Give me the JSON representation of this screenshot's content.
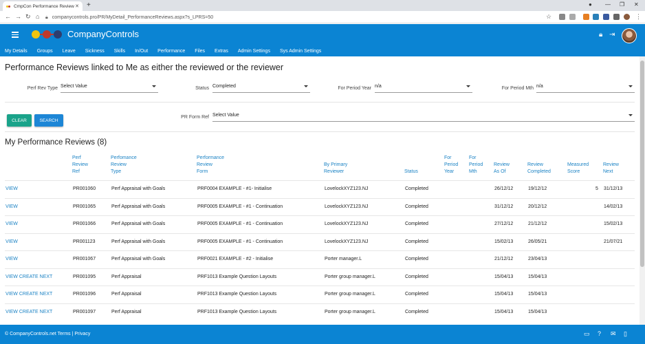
{
  "browser": {
    "tab_title": "CmpCon Performance Review",
    "url": "companycontrols.pro/PR/MyDetail_PerformanceReviews.aspx?s_LPRS=50"
  },
  "app": {
    "brand": "CompanyControls",
    "menu": [
      "My Details",
      "Groups",
      "Leave",
      "Sickness",
      "Skills",
      "In/Out",
      "Performance",
      "Files",
      "Extras",
      "Admin Settings",
      "Sys Admin Settings"
    ]
  },
  "page": {
    "title": "Performance Reviews linked to Me as either the reviewed or the reviewer",
    "filters": {
      "perf_rev_type_label": "Perf Rev Type",
      "perf_rev_type_value": "Select Value",
      "status_label": "Status",
      "status_value": "Completed",
      "period_year_label": "For Period Year",
      "period_year_value": "n/a",
      "period_mth_label": "For Period Mth",
      "period_mth_value": "n/a",
      "form_ref_label": "PR Form Ref",
      "form_ref_value": "Select Value"
    },
    "buttons": {
      "clear": "CLEAR",
      "search": "SEARCH"
    },
    "section_title": "My Performance Reviews (8)"
  },
  "table": {
    "headers": {
      "ref": "Perf\nReview\nRef",
      "type": "Perfomance\nReview\nType",
      "form": "Performance\nReview\nForm",
      "reviewer": "By Primary\nReviewer",
      "status": "Status",
      "year": "For\nPeriod\nYear",
      "mth": "For\nPeriod\nMth",
      "asof": "Review\nAs Of",
      "completed": "Review\nCompleted",
      "score": "Measured\nScore",
      "next": "Review\nNext"
    },
    "rows": [
      {
        "action": "VIEW",
        "ref": "PR001060",
        "type": "Perf Appraisal with Goals",
        "form": "PRF0004 EXAMPLE - #1- Initialise",
        "reviewer": "LovelockXYZ123.NJ",
        "status": "Completed",
        "asof": "26/12/12",
        "completed": "19/12/12",
        "score": "5",
        "next": "31/12/13"
      },
      {
        "action": "VIEW",
        "ref": "PR001065",
        "type": "Perf Appraisal with Goals",
        "form": "PRF0005 EXAMPLE - #1 - Continuation",
        "reviewer": "LovelockXYZ123.NJ",
        "status": "Completed",
        "asof": "31/12/12",
        "completed": "20/12/12",
        "score": "",
        "next": "14/02/13"
      },
      {
        "action": "VIEW",
        "ref": "PR001066",
        "type": "Perf Appraisal with Goals",
        "form": "PRF0005 EXAMPLE - #1 - Continuation",
        "reviewer": "LovelockXYZ123.NJ",
        "status": "Completed",
        "asof": "27/12/12",
        "completed": "21/12/12",
        "score": "",
        "next": "15/02/13"
      },
      {
        "action": "VIEW",
        "ref": "PR001123",
        "type": "Perf Appraisal with Goals",
        "form": "PRF0005 EXAMPLE - #1 - Continuation",
        "reviewer": "LovelockXYZ123.NJ",
        "status": "Completed",
        "asof": "15/02/13",
        "completed": "26/05/21",
        "score": "",
        "next": "21/07/21"
      },
      {
        "action": "VIEW",
        "ref": "PR001067",
        "type": "Perf Appraisal with Goals",
        "form": "PRF0021 EXAMPLE - #2 - Initialise",
        "reviewer": "Porter manager.L",
        "status": "Completed",
        "asof": "21/12/12",
        "completed": "23/04/13",
        "score": "",
        "next": ""
      },
      {
        "action": "VIEW CREATE NEXT",
        "ref": "PR001095",
        "type": "Perf Appraisal",
        "form": "PRF1013 Example Question Layouts",
        "reviewer": "Porter group manager.L",
        "status": "Completed",
        "asof": "15/04/13",
        "completed": "15/04/13",
        "score": "",
        "next": ""
      },
      {
        "action": "VIEW CREATE NEXT",
        "ref": "PR001096",
        "type": "Perf Appraisal",
        "form": "PRF1013 Example Question Layouts",
        "reviewer": "Porter group manager.L",
        "status": "Completed",
        "asof": "15/04/13",
        "completed": "15/04/13",
        "score": "",
        "next": ""
      },
      {
        "action": "VIEW CREATE NEXT",
        "ref": "PR001097",
        "type": "Perf Appraisal",
        "form": "PRF1013 Example Question Layouts",
        "reviewer": "Porter group manager.L",
        "status": "Completed",
        "asof": "15/04/13",
        "completed": "15/04/13",
        "score": "",
        "next": ""
      }
    ]
  },
  "footer": {
    "text": "© CompanyControls.net Terms | Privacy"
  },
  "colors": {
    "primary": "#0b84d3",
    "link": "#1a82c4",
    "clear_button": "#1aa38a",
    "search_button": "#1d86d6"
  }
}
